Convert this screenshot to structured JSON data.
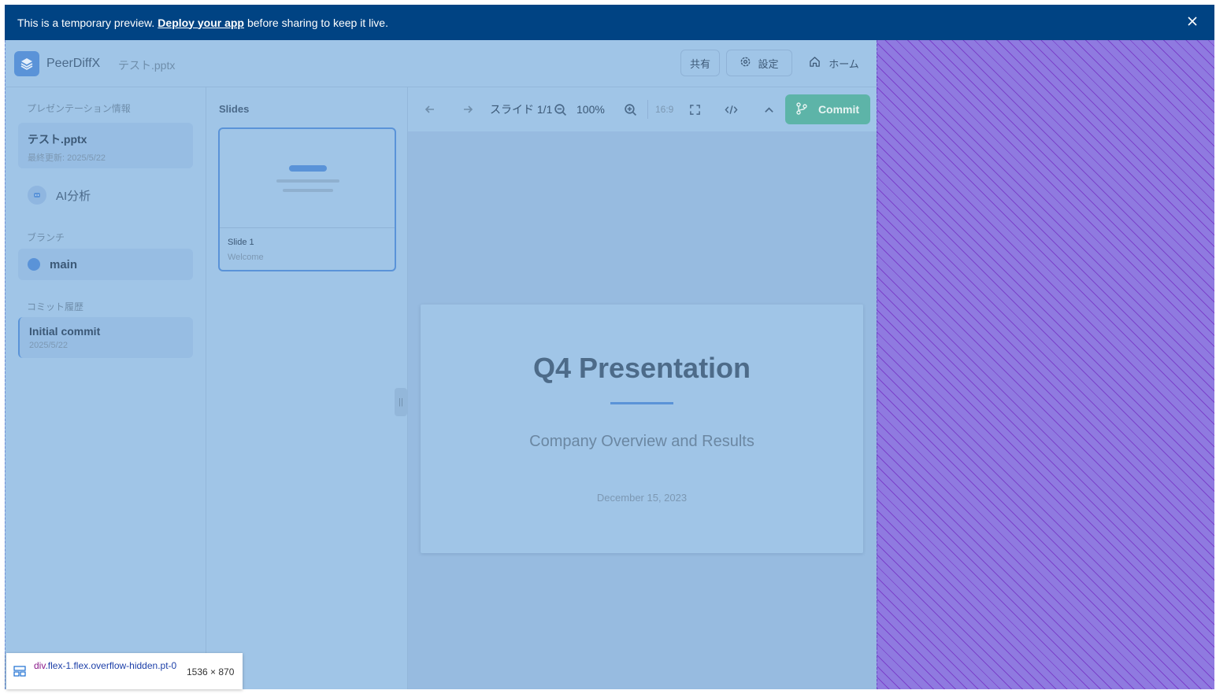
{
  "banner": {
    "prefix": "This is a temporary preview.",
    "link": "Deploy your app",
    "suffix": "before sharing to keep it live."
  },
  "header": {
    "app_name": "PeerDiffX",
    "file_name": "テスト.pptx",
    "share_label": "共有",
    "settings_label": "設定",
    "home_label": "ホーム"
  },
  "sidebar": {
    "info_label": "プレゼンテーション情報",
    "file_title": "テスト.pptx",
    "last_updated": "最終更新: 2025/5/22",
    "ai_label": "AI分析",
    "branch_label": "ブランチ",
    "branch_name": "main",
    "history_label": "コミット履歴",
    "commit_title": "Initial commit",
    "commit_date": "2025/5/22"
  },
  "slides_panel": {
    "title": "Slides",
    "items": [
      {
        "label": "Slide 1",
        "subtitle": "Welcome"
      }
    ],
    "handle": "||"
  },
  "toolbar": {
    "slide_counter": "スライド 1/1",
    "zoom": "100%",
    "aspect": "16:9",
    "commit_label": "Commit"
  },
  "slide": {
    "title": "Q4 Presentation",
    "subtitle": "Company Overview and Results",
    "date": "December 15, 2023"
  },
  "inspector": {
    "tag": "div",
    "selector": ".flex-1.flex.overflow-hidden.pt-0",
    "size": "1536 × 870"
  },
  "colors": {
    "banner": "#004383",
    "overlay": "#a0c5e7",
    "accent": "#5a93d8",
    "commit": "#5db4a8",
    "hatch": "#8f7ae0"
  }
}
